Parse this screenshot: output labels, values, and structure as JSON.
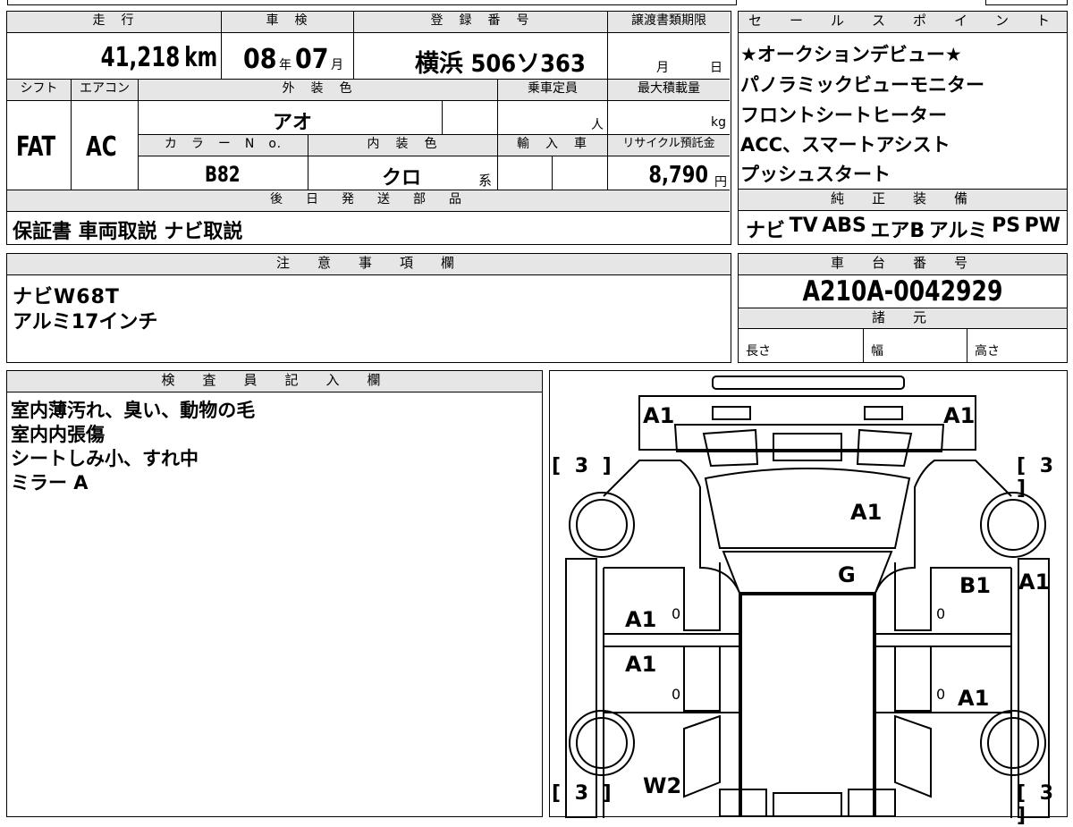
{
  "row1": {
    "headers": {
      "mileage": "走　行",
      "inspection": "車　検",
      "registration": "登　録　番　号",
      "transfer_deadline": "譲渡書類期限"
    },
    "mileage_value": "41,218",
    "mileage_unit": "km",
    "inspection_year": "08",
    "year_unit": "年",
    "inspection_month": "07",
    "month_unit": "月",
    "registration_number": "横浜 506ソ363",
    "deadline_month": "月",
    "deadline_day": "日"
  },
  "row2": {
    "headers": {
      "shift": "シフト",
      "ac": "エアコン",
      "exterior_color": "外　装　色",
      "capacity": "乗車定員",
      "max_load": "最大積載量",
      "color_no": "カ　ラ　ー　N　o.",
      "interior_color": "内　装　色",
      "import": "輸　入　車",
      "recycle": "リサイクル預託金"
    },
    "shift_value": "FAT",
    "ac_value": "AC",
    "exterior_color_value": "アオ",
    "capacity_unit": "人",
    "max_load_unit": "kg",
    "color_no_value": "B82",
    "interior_color_value": "クロ",
    "interior_suffix": "系",
    "recycle_value": "8,790",
    "recycle_unit": "円"
  },
  "later_parts": {
    "header": "後　日　発　送　部　品",
    "value": "保証書 車両取説 ナビ取説"
  },
  "selling_points": {
    "header": "セ　ー　ル　ス　ポ　イ　ン　ト",
    "items": [
      "★オークションデビュー★",
      "パノラミックビューモニター",
      "フロントシートヒーター",
      "ACC、スマートアシスト",
      "プッシュスタート"
    ]
  },
  "genuine_equipment": {
    "header": "純　正　装　備",
    "items": [
      "ナビ",
      "TV",
      "ABS",
      "エアB",
      "アルミ",
      "PS",
      "PW"
    ]
  },
  "notes": {
    "header": "注　意　事　項　欄",
    "lines": [
      "ナビW68T",
      "アルミ17インチ"
    ]
  },
  "chassis": {
    "header": "車　台　番　号",
    "value": "A210A-0042929"
  },
  "specs": {
    "header": "諸　元",
    "length": "長さ",
    "width": "幅",
    "height": "高さ"
  },
  "inspector": {
    "header": "検　査　員　記　入　欄",
    "lines": [
      "室内薄汚れ、臭い、動物の毛",
      "室内内張傷",
      "シートしみ小、すれ中",
      "ミラー A"
    ]
  },
  "diagram": {
    "marks": {
      "front_left": "A1",
      "front_right": "A1",
      "hood": "A1",
      "windshield": "G",
      "left_front_door": "A1",
      "left_rear_door": "A1",
      "right_front_door": "B1",
      "right_rear_door": "A1",
      "right_fender": "A1",
      "left_rear_quarter": "W2"
    },
    "tire_fl": "[ 3 ]",
    "tire_fr": "[ 3 ]",
    "tire_rl": "[ 3 ]",
    "tire_rr": "[ 3 ]",
    "door_zero": "0"
  }
}
